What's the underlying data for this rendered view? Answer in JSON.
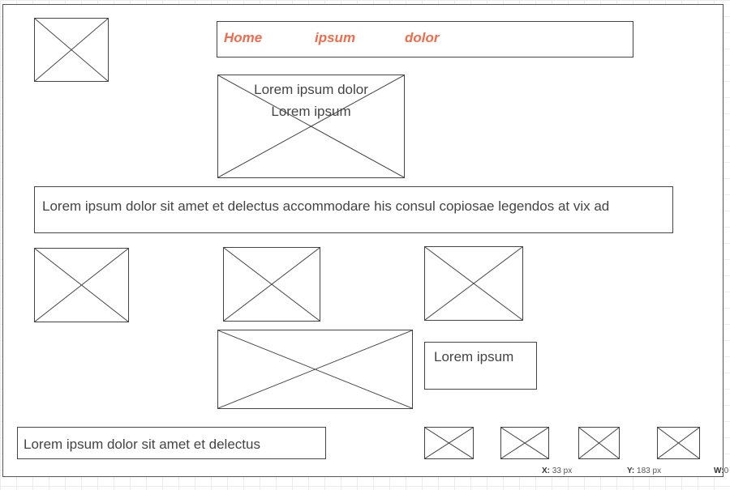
{
  "nav": {
    "items": [
      {
        "label": "Home"
      },
      {
        "label": "ipsum"
      },
      {
        "label": "dolor"
      }
    ]
  },
  "hero": {
    "line1": "Lorem ipsum dolor",
    "line2": "Lorem ipsum"
  },
  "banner": {
    "text": "Lorem ipsum dolor sit amet et delectus accommodare his consul copiosae legendos at vix ad"
  },
  "side_box": {
    "text": "Lorem ipsum"
  },
  "footer_box": {
    "text": "Lorem ipsum dolor sit amet et delectus"
  },
  "status_bar": {
    "x_label": "X:",
    "x_value": "33 px",
    "y_label": "Y:",
    "y_value": "183 px",
    "w_label": "W:",
    "w_value": "0"
  },
  "colors": {
    "nav_text": "#f26b4b",
    "border": "#444444"
  }
}
